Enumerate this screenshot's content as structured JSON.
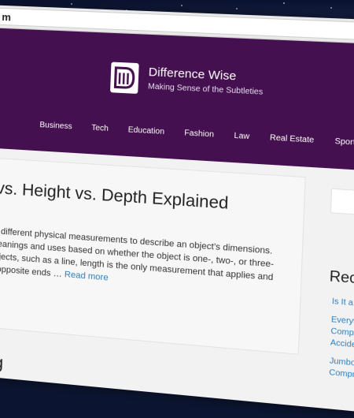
{
  "browser": {
    "address_text": "m"
  },
  "site": {
    "title": "Difference Wise",
    "tagline": "Making Sense of the Subtleties"
  },
  "nav": {
    "items": [
      "Business",
      "Tech",
      "Education",
      "Fashion",
      "Law",
      "Real Estate",
      "Sports"
    ]
  },
  "article": {
    "title": "th vs. Height vs. Depth Explained",
    "excerpt_lines": [
      "th are different physical measurements to describe an object’s dimensions.",
      "ent meanings and uses based on whether the object is one-, two-, or three-",
      "nal objects, such as a line, length is the only measurement that applies and",
      "n the opposite ends …"
    ],
    "read_more": "Read more"
  },
  "next_article": {
    "title_fragment": "ping"
  },
  "sidebar": {
    "recent_heading": "Rec",
    "recent_items": [
      [
        "Is It a F"
      ],
      [
        "Everyth",
        "Compe",
        "Accider"
      ],
      [
        "Jumbo",
        "Compr"
      ]
    ]
  },
  "colors": {
    "header_bg": "#45104f",
    "link": "#2a7fbf"
  }
}
